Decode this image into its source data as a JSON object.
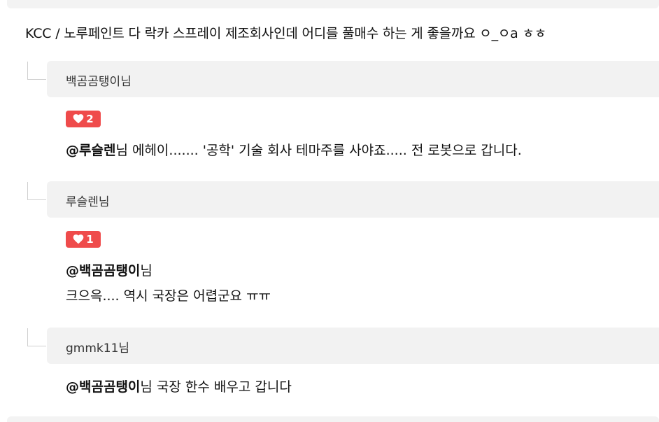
{
  "post": {
    "text": "KCC / 노루페인트 다 락카 스프레이 제조회사인데 어디를 풀매수 하는 게 좋을까요 ㅇ_ㅇa ㅎㅎ"
  },
  "replies": [
    {
      "author": "백곰곰탱이",
      "author_suffix": "님",
      "likes": "2",
      "mention": "@루슬렌",
      "mention_suffix": "님",
      "body_line1": " 에헤이....... '공학' 기술 회사 테마주를 사야죠..... 전 로봇으로 갑니다.",
      "body_line2": ""
    },
    {
      "author": "루슬렌",
      "author_suffix": "님",
      "likes": "1",
      "mention": "@백곰곰탱이",
      "mention_suffix": "님",
      "body_line1": "",
      "body_line2": "크으윽.... 역시 국장은 어렵군요 ㅠㅠ"
    },
    {
      "author": "gmmk11",
      "author_suffix": "님",
      "likes": "",
      "mention": "@백곰곰탱이",
      "mention_suffix": "님",
      "body_line1": " 국장 한수 배우고 갑니다",
      "body_line2": ""
    }
  ],
  "colors": {
    "like_badge": "#ef4b4b",
    "author_bar": "#f2f2f2"
  },
  "icons": {
    "like": "heart-icon"
  }
}
